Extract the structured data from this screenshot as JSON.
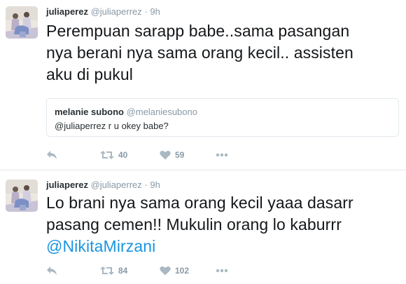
{
  "tweets": [
    {
      "fullname": "juliaperez",
      "username": "@juliaperrez",
      "separator": "·",
      "time": "9h",
      "text_lines": [
        "Perempuan sarapp babe..sama pasangan",
        "nya berani nya sama orang kecil.. assisten",
        "aku di pukul"
      ],
      "quote": {
        "name": "melanie subono",
        "handle": "@melaniesubono",
        "text": "@juliaperrez r u okey babe?"
      },
      "retweets": "40",
      "likes": "59"
    },
    {
      "fullname": "juliaperez",
      "username": "@juliaperrez",
      "separator": "·",
      "time": "9h",
      "text_lines": [
        "Lo brani nya sama orang kecil yaaa dasarr",
        "pasang cemen!! Mukulin orang lo kaburrr"
      ],
      "mention": "@NikitaMirzani",
      "retweets": "84",
      "likes": "102"
    }
  ],
  "icons": {
    "reply": "reply-icon",
    "retweet": "retweet-icon",
    "like": "heart-icon",
    "more": "more-icon"
  },
  "colors": {
    "name": "#292f33",
    "muted": "#8899a6",
    "icon": "#aab8c2",
    "link": "#1b95e0",
    "border": "#e1e8ed"
  }
}
